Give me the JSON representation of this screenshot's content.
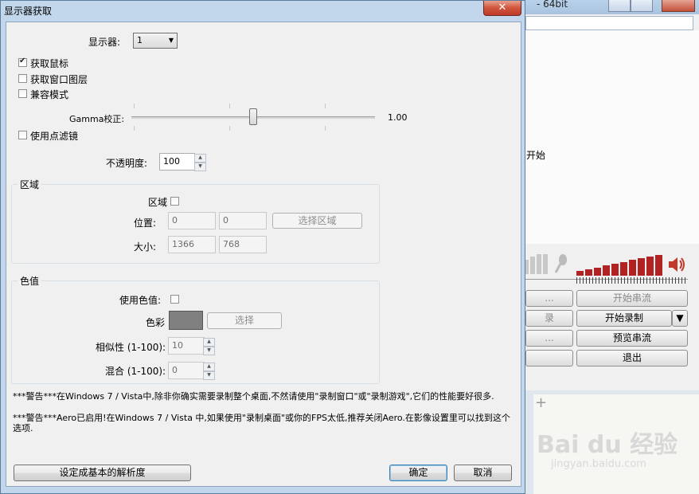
{
  "dialog": {
    "title": "显示器获取",
    "close_glyph": "✕",
    "monitor_label": "显示器:",
    "monitor_value": "1",
    "capture_cursor": {
      "label": "获取鼠标",
      "checked": true
    },
    "capture_layered": {
      "label": "获取窗口图层",
      "checked": false
    },
    "compat_mode": {
      "label": "兼容模式",
      "checked": false
    },
    "gamma_label": "Gamma校正:",
    "gamma_value": "1.00",
    "gamma_level": 0.5,
    "point_filter": {
      "label": "使用点滤镜",
      "checked": false
    },
    "opacity_label": "不透明度:",
    "opacity_value": "100",
    "region_group": {
      "title": "区域",
      "region_label": "区域",
      "position_label": "位置:",
      "pos_x": "0",
      "pos_y": "0",
      "select_region_button": "选择区域",
      "size_label": "大小:",
      "width": "1366",
      "height": "768"
    },
    "color_group": {
      "title": "色值",
      "use_color_label": "使用色值:",
      "color_label": "色彩",
      "swatch_color": "#808080",
      "select_button": "选择",
      "similarity_label": "相似性 (1-100):",
      "similarity_value": "10",
      "blend_label": "混合 (1-100):",
      "blend_value": "0"
    },
    "warning1": "***警告***在Windows 7 / Vista中,除非你确实需要录制整个桌面,不然请使用\"录制窗口\"或\"录制游戏\",它们的性能要好很多.",
    "warning2": "***警告***Aero已启用!在Windows 7 / Vista 中,如果使用\"录制桌面\"或你的FPS太低,推荐关闭Aero.在影像设置里可以找到这个选项.",
    "set_base_res_button": "设定成基本的解析度",
    "ok_button": "确定",
    "cancel_button": "取消"
  },
  "background": {
    "title_fragment": "- 64bit",
    "start_fragment": "开始",
    "start_streaming": "开始串流",
    "start_recording": "开始录制",
    "preview_stream": "预览串流",
    "exit": "退出",
    "left_fragments": [
      "...",
      "录",
      "...",
      ""
    ],
    "meter_color": "#b22222"
  },
  "watermark": {
    "brand": "Bai du 经验",
    "url": "jingyan.baidu.com"
  }
}
